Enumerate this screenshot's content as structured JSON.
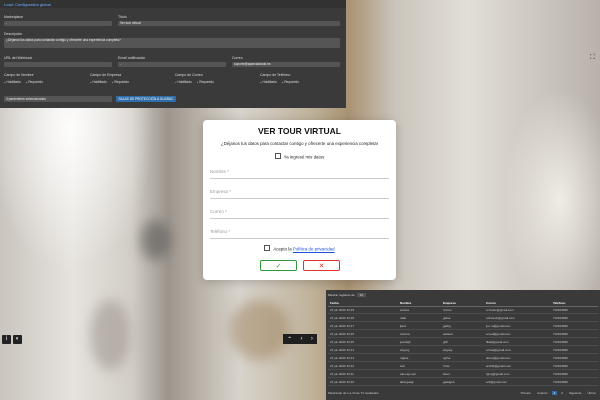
{
  "config": {
    "header": "Load: Configuration global",
    "fields": {
      "marketplace_label": "Marketplace",
      "marketplace_value": "-",
      "title_label": "Título",
      "title_value": "Ver tour virtual",
      "description_label": "Descripción",
      "description_value": "¿Dejanos tus datos para contactar contigo y ofrecerte una experiencia completa?",
      "url_label": "URL del Webhook",
      "notify_label": "Email notificación",
      "notify_value": "-",
      "email_label": "Correo",
      "email_value": "soporte@aparcalotodo.es"
    },
    "checks": [
      {
        "label": "Campo de Nombre",
        "opts": [
          "Habilitado",
          "Requerido"
        ]
      },
      {
        "label": "Campo de Empresa",
        "opts": [
          "Habilitado",
          "Requerido"
        ]
      },
      {
        "label": "Campo de Correo",
        "opts": [
          "Habilitado",
          "Requerido"
        ]
      },
      {
        "label": "Campo de Teléfono",
        "opts": [
          "Habilitado",
          "Requerido"
        ]
      }
    ],
    "select_value": "4 parámetros seleccionados",
    "button": "SALAS DE PROTECCIÓN A GUARAC"
  },
  "modal": {
    "title": "VER TOUR VIRTUAL",
    "subtitle": "¿Déjanos tus datos para contactar contigo y ofrecerte una experiencia completa!",
    "already": "Ya ingresé mis datos",
    "placeholders": {
      "name": "Nombre *",
      "company": "Empresa *",
      "email": "Correo *",
      "phone": "Teléfono *"
    },
    "accept_prefix": "Acepto la",
    "accept_link": "Política de privacidad",
    "ok_symbol": "✓",
    "cancel_symbol": "✕"
  },
  "controls": {
    "info": "i",
    "theme": "◐",
    "nav_up": "⌃",
    "nav_prev": "‹",
    "nav_next": "›",
    "fullscreen": "⛶"
  },
  "table": {
    "show_label": "Mostrar registros de",
    "show_value": "10",
    "headers": [
      "Fecha",
      "Nombre",
      "Empresa",
      "Correo",
      "Teléfono"
    ],
    "rows": [
      [
        "21 jun 2020 13:19",
        "andrés",
        "nrzaro",
        "or.thodo@gmail.com",
        "711624990"
      ],
      [
        "21 jun 2020 13:18",
        "rafal",
        "gtdsa",
        "refrsandr@gmail.com",
        "711624990"
      ],
      [
        "21 jun 2020 13:17",
        "ljard",
        "gatftg",
        "jun.ru@gmail.com",
        "711624990"
      ],
      [
        "21 jun 2020 13:16",
        "victoria",
        "asdsed",
        "erved@gmail.com",
        "711624990"
      ],
      [
        "21 jun 2020 13:15",
        "juandgb",
        "gldr",
        "fiklal@gmail.com",
        "711624990"
      ],
      [
        "21 jun 2020 13:14",
        "ehgurg",
        "ehgurg",
        "ochsd@gmail.com",
        "711624990"
      ],
      [
        "21 jun 2020 13:13",
        "rdgfsa",
        "sgtha",
        "abrec@gmail.com",
        "711624990"
      ],
      [
        "21 jun 2020 13:12",
        "sofi",
        "frrwe",
        "andtbt@gmail.com",
        "711624990"
      ],
      [
        "21 jun 2020 13:11",
        "sam-ajn-opt",
        "fanel",
        "fgcrg@gmail.com",
        "711624990"
      ],
      [
        "21 jun 2020 13:10",
        "albergatgf",
        "gaddgsh",
        "ertf@gmail.com",
        "711624990"
      ]
    ],
    "footer_info": "Mostrando de 1 a 10 de 71 resultados",
    "pager": [
      "Primero",
      "Anterior",
      "1",
      "2",
      "Siguiente",
      "Último"
    ]
  }
}
